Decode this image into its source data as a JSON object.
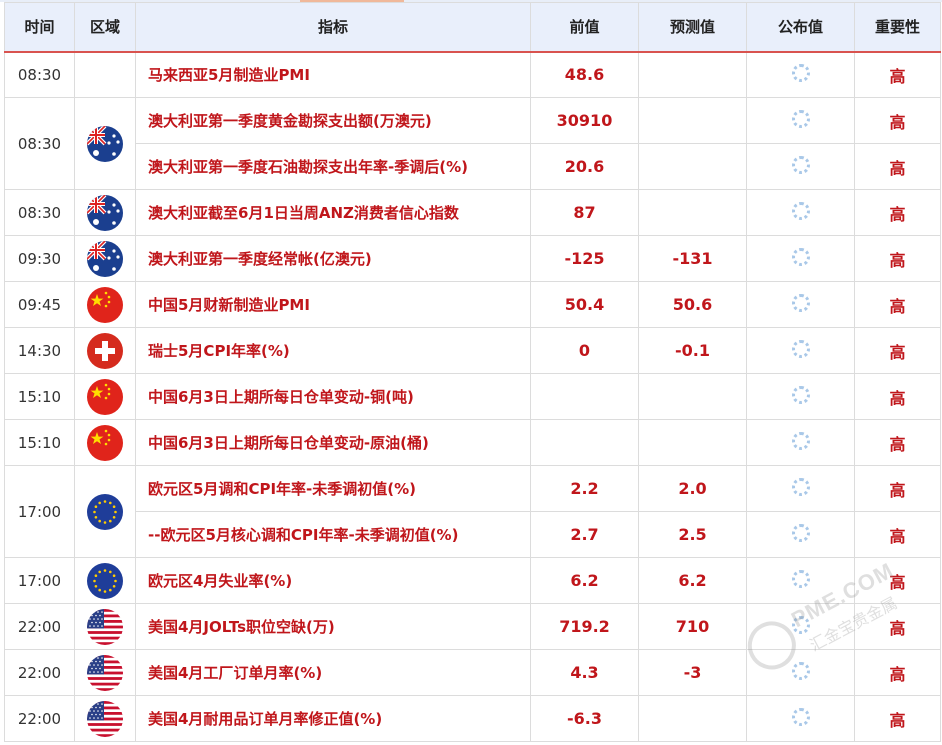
{
  "columns": {
    "time": "时间",
    "region": "区域",
    "indicator": "指标",
    "previous": "前值",
    "forecast": "预测值",
    "actual": "公布值",
    "importance": "重要性"
  },
  "groups": [
    {
      "time": "08:30",
      "flag": "none",
      "rows": [
        {
          "indicator": "马来西亚5月制造业PMI",
          "previous": "48.6",
          "forecast": "",
          "importance": "高"
        }
      ]
    },
    {
      "time": "08:30",
      "flag": "australia-flag",
      "rows": [
        {
          "indicator": "澳大利亚第一季度黄金勘探支出额(万澳元)",
          "previous": "30910",
          "forecast": "",
          "importance": "高"
        },
        {
          "indicator": "澳大利亚第一季度石油勘探支出年率-季调后(%)",
          "previous": "20.6",
          "forecast": "",
          "importance": "高"
        }
      ]
    },
    {
      "time": "08:30",
      "flag": "australia-flag",
      "rows": [
        {
          "indicator": "澳大利亚截至6月1日当周ANZ消费者信心指数",
          "previous": "87",
          "forecast": "",
          "importance": "高"
        }
      ]
    },
    {
      "time": "09:30",
      "flag": "australia-flag",
      "rows": [
        {
          "indicator": "澳大利亚第一季度经常帐(亿澳元)",
          "previous": "-125",
          "forecast": "-131",
          "importance": "高"
        }
      ]
    },
    {
      "time": "09:45",
      "flag": "china-flag",
      "rows": [
        {
          "indicator": "中国5月财新制造业PMI",
          "previous": "50.4",
          "forecast": "50.6",
          "importance": "高"
        }
      ]
    },
    {
      "time": "14:30",
      "flag": "switzerland-flag",
      "rows": [
        {
          "indicator": "瑞士5月CPI年率(%)",
          "previous": "0",
          "forecast": "-0.1",
          "importance": "高"
        }
      ]
    },
    {
      "time": "15:10",
      "flag": "china-flag",
      "rows": [
        {
          "indicator": "中国6月3日上期所每日仓单变动-铜(吨)",
          "previous": "",
          "forecast": "",
          "importance": "高"
        }
      ]
    },
    {
      "time": "15:10",
      "flag": "china-flag",
      "rows": [
        {
          "indicator": "中国6月3日上期所每日仓单变动-原油(桶)",
          "previous": "",
          "forecast": "",
          "importance": "高"
        }
      ]
    },
    {
      "time": "17:00",
      "flag": "eu-flag",
      "rows": [
        {
          "indicator": "欧元区5月调和CPI年率-未季调初值(%)",
          "previous": "2.2",
          "forecast": "2.0",
          "importance": "高"
        },
        {
          "indicator": "--欧元区5月核心调和CPI年率-未季调初值(%)",
          "previous": "2.7",
          "forecast": "2.5",
          "importance": "高"
        }
      ]
    },
    {
      "time": "17:00",
      "flag": "eu-flag",
      "rows": [
        {
          "indicator": "欧元区4月失业率(%)",
          "previous": "6.2",
          "forecast": "6.2",
          "importance": "高"
        }
      ]
    },
    {
      "time": "22:00",
      "flag": "usa-flag",
      "rows": [
        {
          "indicator": "美国4月JOLTs职位空缺(万)",
          "previous": "719.2",
          "forecast": "710",
          "importance": "高"
        }
      ]
    },
    {
      "time": "22:00",
      "flag": "usa-flag",
      "rows": [
        {
          "indicator": "美国4月工厂订单月率(%)",
          "previous": "4.3",
          "forecast": "-3",
          "importance": "高"
        }
      ]
    },
    {
      "time": "22:00",
      "flag": "usa-flag",
      "rows": [
        {
          "indicator": "美国4月耐用品订单月率修正值(%)",
          "previous": "-6.3",
          "forecast": "",
          "importance": "高"
        }
      ]
    }
  ],
  "actual_icon": "loading-spinner-icon",
  "watermark": {
    "text": "PME.COM",
    "sub": "汇金宝贵金属"
  },
  "colors": {
    "header_bg": "#e9effb",
    "accent_red": "#c0161b",
    "header_rule": "#d9534f"
  }
}
